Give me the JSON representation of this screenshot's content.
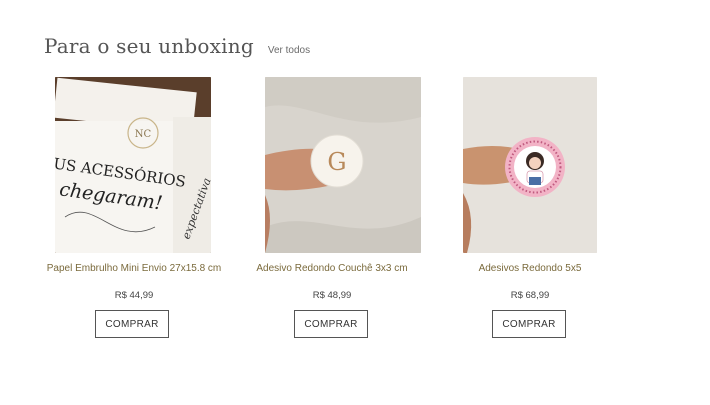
{
  "section": {
    "title": "Para o seu unboxing",
    "see_all": "Ver todos"
  },
  "products": [
    {
      "name": "Papel Embrulho Mini Envio 27x15.8 cm",
      "price": "R$ 44,99",
      "button": "COMPRAR",
      "image_text": [
        "NC",
        "US ACESSÓRIOS",
        "chegaram!",
        "expectativa"
      ]
    },
    {
      "name": "Adesivo Redondo Couchê 3x3 cm",
      "price": "R$ 48,99",
      "button": "COMPRAR",
      "image_text": [
        "G"
      ]
    },
    {
      "name": "Adesivos Redondo 5x5",
      "price": "R$ 68,99",
      "button": "COMPRAR",
      "image_text": []
    }
  ]
}
